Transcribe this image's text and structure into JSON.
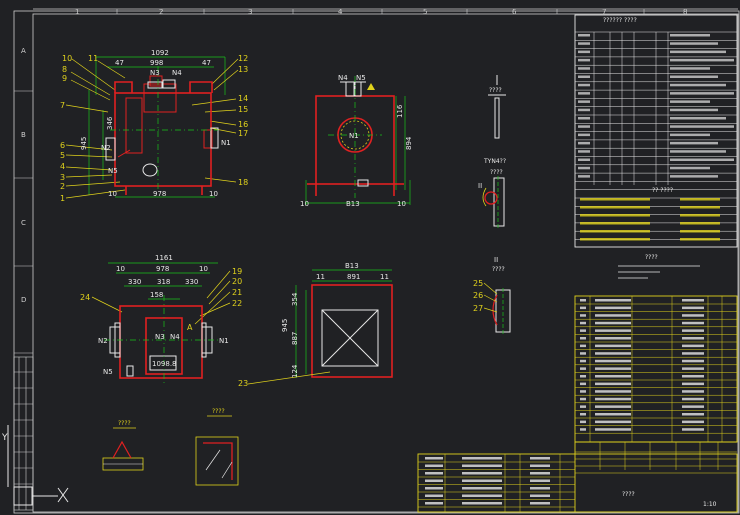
{
  "frame": {
    "col_numbers": [
      "1",
      "2",
      "3",
      "4",
      "5",
      "6",
      "7",
      "8"
    ],
    "row_letters": [
      "A",
      "B",
      "C",
      "D"
    ],
    "axis_x_label": "X",
    "axis_y_label": "Y"
  },
  "front_view": {
    "dims": {
      "overall": "1092",
      "inner": "998",
      "half_left": "47",
      "half_right": "47",
      "left_height": "945",
      "body_height": "346",
      "bottom": "978",
      "left_small": "10",
      "right_small": "10"
    },
    "nozzles": {
      "n3": "N3",
      "n4": "N4",
      "n2": "N2",
      "n5": "N5",
      "n1": "N1"
    },
    "callouts": [
      "10",
      "11",
      "8",
      "9",
      "7",
      "6",
      "5",
      "4",
      "3",
      "2",
      "1",
      "12",
      "13",
      "14",
      "15",
      "16",
      "17",
      "18",
      "19"
    ]
  },
  "side_view": {
    "n4": "N4",
    "n5": "N5",
    "n1": "N1",
    "dim_right": "894",
    "dim_right_small": "116",
    "bottom_left": "10",
    "bottom_mid": "B13",
    "bottom_right": "10"
  },
  "plan_view": {
    "top": "1161",
    "second_left": "10",
    "second_mid": "978",
    "second_right": "10",
    "third": [
      "330",
      "318",
      "330"
    ],
    "inner": "158",
    "n3": "N3",
    "n4": "N4",
    "n2": "N2",
    "n1": "N1",
    "n5": "N5",
    "box": "1098.8",
    "callouts": [
      "24",
      "19",
      "20",
      "21",
      "22",
      "A"
    ]
  },
  "base_view": {
    "top": "B13",
    "second": [
      "11",
      "891",
      "11"
    ],
    "left_outer": "945",
    "left_inner": "887",
    "left_a": "354",
    "left_b": "124",
    "callout": "23"
  },
  "detail_views": {
    "detail1": "????",
    "detail_ii": "II",
    "detail_ii_title": "????",
    "detail_ii_title2": "????",
    "detail_label": "TYN4??",
    "detail_a": "????",
    "callouts": [
      "25",
      "26",
      "27"
    ],
    "small1": "????",
    "small2": "????"
  },
  "notes_title": "????",
  "table_header_title": "??????  ????",
  "list_title": "??  ????",
  "title_block": {
    "name": "????",
    "scale": "1:10"
  },
  "colors": {
    "red": "#e02121",
    "yellow": "#e0d21c",
    "green": "#19c219",
    "white": "#e8e8e8",
    "cyan": "#1ec8d8"
  }
}
